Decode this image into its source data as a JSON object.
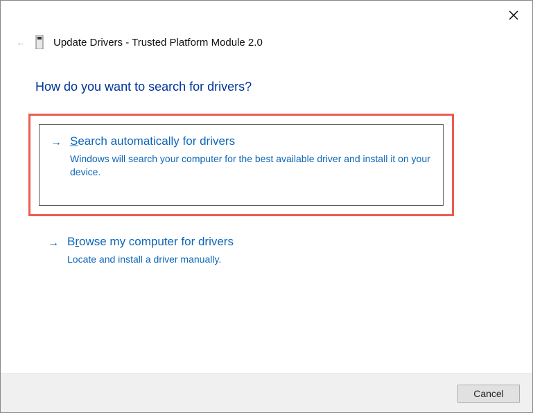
{
  "header": {
    "title": "Update Drivers - Trusted Platform Module 2.0"
  },
  "main": {
    "heading": "How do you want to search for drivers?"
  },
  "options": [
    {
      "accel": "S",
      "title_rest": "earch automatically for drivers",
      "description": "Windows will search your computer for the best available driver and install it on your device."
    },
    {
      "accel_prefix": "B",
      "accel": "r",
      "title_rest": "owse my computer for drivers",
      "description": "Locate and install a driver manually."
    }
  ],
  "footer": {
    "cancel_label": "Cancel"
  }
}
